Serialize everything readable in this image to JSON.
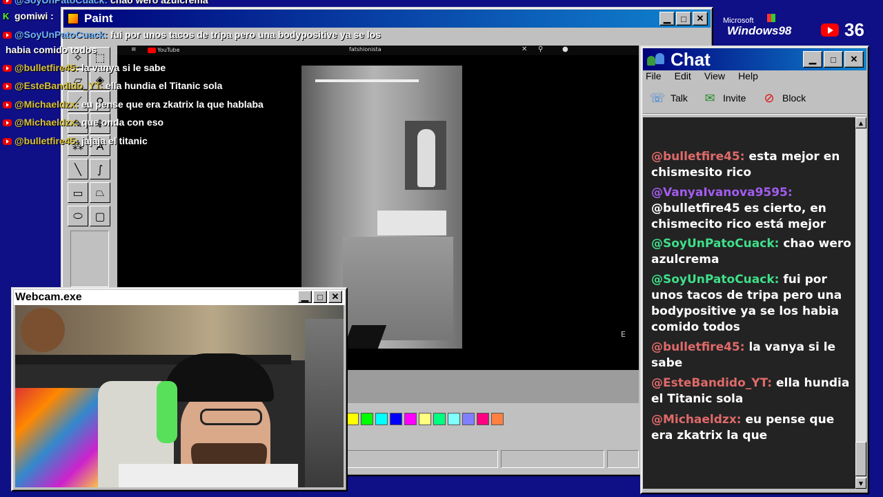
{
  "overlay_chat": [
    {
      "user": "@SoyUnPatoCuack:",
      "text": "chao wero azulcrema",
      "user_color": "#6fb4ff",
      "icon": "youtube-icon"
    },
    {
      "user": "gomiwi :",
      "text": "",
      "user_color": "#ffffff",
      "icon": "kick-icon"
    },
    {
      "user": "@SoyUnPatoCuack:",
      "text": "fui por unos tacos de tripa pero una bodypositive ya se los",
      "user_color": "#6fb4ff",
      "icon": "youtube-icon"
    },
    {
      "user": "",
      "text": "habia comido todos",
      "user_color": "#ffffff",
      "icon": ""
    },
    {
      "user": "@bulletfire45:",
      "text": "la vanya si le sabe",
      "user_color": "#d8c23a",
      "icon": "youtube-icon"
    },
    {
      "user": "@EsteBandido_YT:",
      "text": "ella hundia el Titanic sola",
      "user_color": "#d8c23a",
      "icon": "youtube-icon"
    },
    {
      "user": "@Michaeldzx:",
      "text": "eu pense que era zkatrix la que hablaba",
      "user_color": "#d8c23a",
      "icon": "youtube-icon"
    },
    {
      "user": "@Michaeldzx:",
      "text": "que onda con eso",
      "user_color": "#d8c23a",
      "icon": "youtube-icon"
    },
    {
      "user": "@bulletfire45:",
      "text": "jajaja el titanic",
      "user_color": "#d8c23a",
      "icon": "youtube-icon"
    }
  ],
  "paint": {
    "title": "Paint",
    "youtube_label": "YouTube",
    "search_text": "fatshionista",
    "palette": [
      "#ffff00",
      "#00ff00",
      "#00ffff",
      "#0000ff",
      "#ff00ff",
      "#ffff80",
      "#00ff80",
      "#80ffff",
      "#8080ff",
      "#ff0080",
      "#ff8040"
    ]
  },
  "branding": {
    "windows_top": "Microsoft",
    "windows_main": "Windows98",
    "viewer_count": "36"
  },
  "chat": {
    "title": "Chat",
    "menu": [
      "File",
      "Edit",
      "View",
      "Help"
    ],
    "toolbar": {
      "talk": "Talk",
      "invite": "Invite",
      "block": "Block"
    },
    "messages": [
      {
        "user": "@bulletfire45:",
        "text": "esta mejor en chismesito rico",
        "color": "#e06a6a"
      },
      {
        "user": "@VanyaIvanova9595:",
        "text": "@bulletfire45 es cierto, en chismecito rico está mejor",
        "color": "#a35cf0"
      },
      {
        "user": "@SoyUnPatoCuack:",
        "text": "chao wero azulcrema",
        "color": "#3fe08a"
      },
      {
        "user": "@SoyUnPatoCuack:",
        "text": "fui por unos tacos de tripa pero una bodypositive ya se los habia comido todos",
        "color": "#3fe08a"
      },
      {
        "user": "@bulletfire45:",
        "text": "la vanya si le sabe",
        "color": "#e06a6a"
      },
      {
        "user": "@EsteBandido_YT:",
        "text": "ella hundia el Titanic sola",
        "color": "#e06a6a"
      },
      {
        "user": "@Michaeldzx:",
        "text": "eu pense que era zkatrix la que",
        "color": "#e06a6a"
      }
    ]
  },
  "webcam": {
    "title": "Webcam.exe"
  }
}
